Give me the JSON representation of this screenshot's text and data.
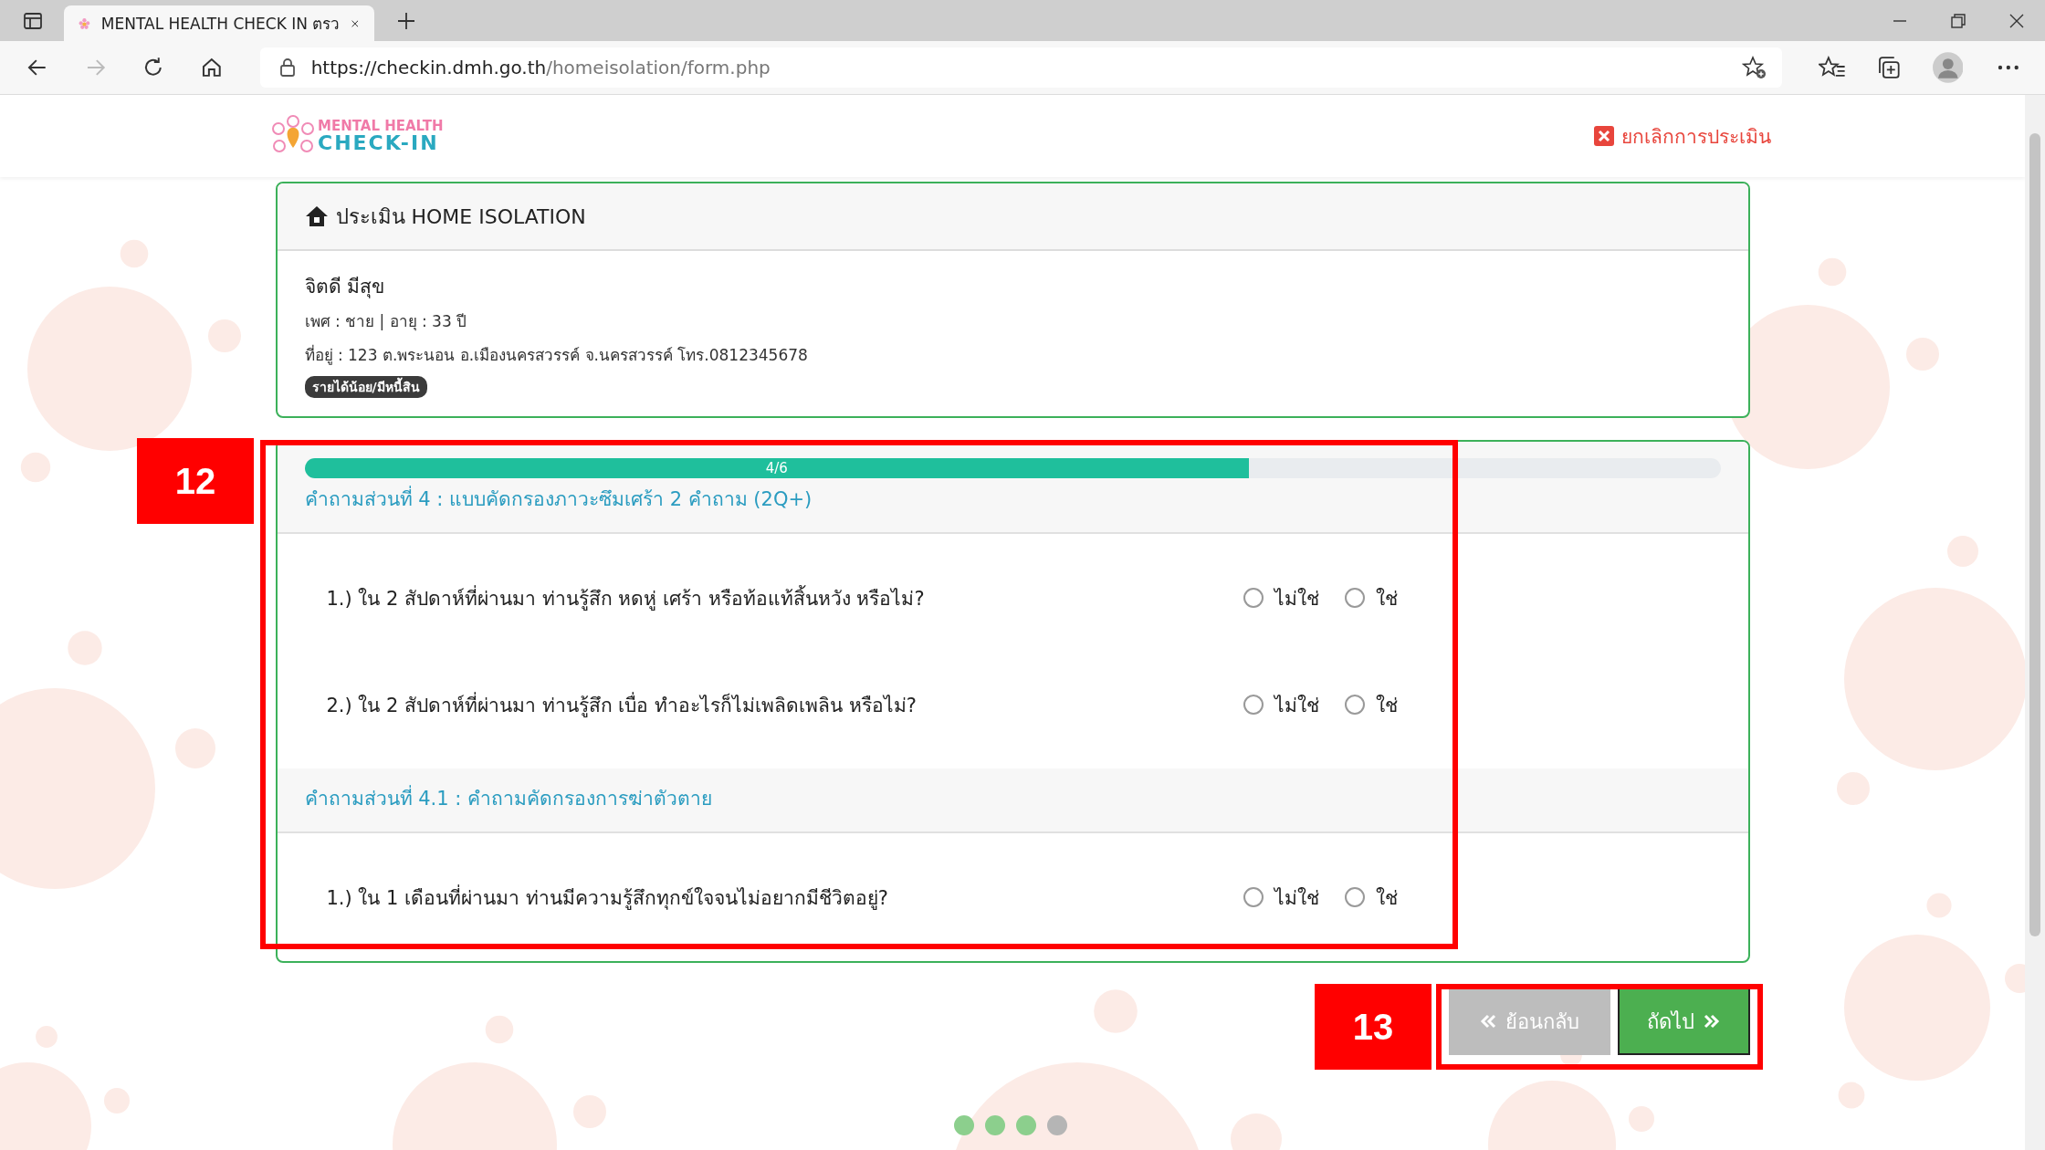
{
  "browser": {
    "tab_title": "MENTAL HEALTH CHECK IN ตรว",
    "url_host": "https://checkin.dmh.go.th",
    "url_path": "/homeisolation/form.php"
  },
  "header": {
    "logo_line1": "MENTAL HEALTH",
    "logo_line2": "CHECK-IN",
    "cancel_link": "ยกเลิกการประเมิน"
  },
  "profile_card": {
    "title": "ประเมิน HOME ISOLATION",
    "name": "จิตดี มีสุข",
    "details": "เพศ : ชาย | อายุ : 33 ปี",
    "address": "ที่อยู่ : 123 ต.พระนอน อ.เมืองนครสวรรค์ จ.นครสวรรค์ โทร.0812345678",
    "tag": "รายได้น้อย/มีหนี้สิน"
  },
  "form": {
    "progress": {
      "label": "4/6",
      "level": 0.667
    },
    "sections": [
      {
        "title": "คำถามส่วนที่ 4 : แบบคัดกรองภาวะซึมเศร้า 2 คำถาม (2Q+)",
        "questions": [
          {
            "text": "1.) ใน 2 สัปดาห์ที่ผ่านมา ท่านรู้สึก หดหู่ เศร้า หรือท้อแท้สิ้นหวัง หรือไม่?",
            "options": [
              {
                "label": "ไม่ใช่",
                "selected": false
              },
              {
                "label": "ใช่",
                "selected": false
              }
            ]
          },
          {
            "text": "2.) ใน 2 สัปดาห์ที่ผ่านมา ท่านรู้สึก เบื่อ ทำอะไรก็ไม่เพลิดเพลิน หรือไม่?",
            "options": [
              {
                "label": "ไม่ใช่",
                "selected": false
              },
              {
                "label": "ใช่",
                "selected": false
              }
            ]
          }
        ]
      },
      {
        "title": "คำถามส่วนที่ 4.1 : คำถามคัดกรองการฆ่าตัวตาย",
        "questions": [
          {
            "text": "1.) ใน 1 เดือนที่ผ่านมา ท่านมีความรู้สึกทุกข์ใจจนไม่อยากมีชีวิตอยู่?",
            "options": [
              {
                "label": "ไม่ใช่",
                "selected": false
              },
              {
                "label": "ใช่",
                "selected": false
              }
            ]
          }
        ]
      }
    ]
  },
  "buttons": [
    {
      "kind": "back",
      "label": "ย้อนกลับ"
    },
    {
      "kind": "next",
      "label": "ถัดไป"
    }
  ],
  "steps": [
    {
      "done": true
    },
    {
      "done": true
    },
    {
      "done": true
    },
    {
      "done": false
    }
  ],
  "annotations": [
    {
      "label": "12"
    },
    {
      "label": "13"
    }
  ]
}
